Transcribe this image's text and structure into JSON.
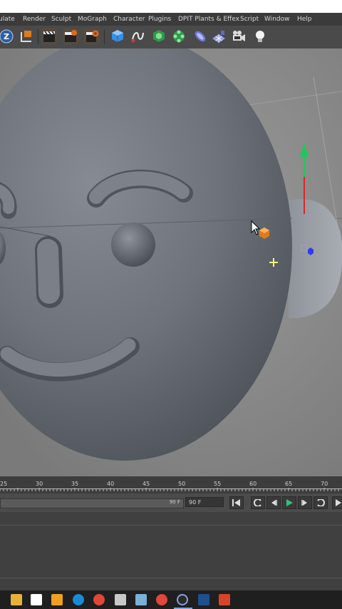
{
  "menu": [
    "ulate",
    "Render",
    "Sculpt",
    "MoGraph",
    "Character",
    "Plugins",
    "DPIT Plants & Effex",
    "Script",
    "Window",
    "Help"
  ],
  "toolbar_icons": [
    "z-icon",
    "coordinate-icon",
    "render-view-icon",
    "render-picture-icon",
    "render-settings-icon",
    "cube-icon",
    "spline-icon",
    "generator-icon",
    "array-icon",
    "deformer-icon",
    "floor-icon",
    "camera-icon",
    "light-icon"
  ],
  "timeline": {
    "ticks": [
      "25",
      "30",
      "35",
      "40",
      "45",
      "50",
      "55",
      "60",
      "65",
      "70"
    ]
  },
  "controls": {
    "slider_value": "90 F",
    "current_frame": "90 F"
  },
  "taskbar_icons": [
    "file-explorer-icon",
    "store-icon",
    "app-icon",
    "edge-icon",
    "chrome-icon",
    "calculator-icon",
    "notes-icon",
    "chrome-icon",
    "cinema4d-icon",
    "photoshop-icon",
    "office-icon"
  ],
  "colors": {
    "menubar": "#3b3b3b",
    "toolbar": "#4a4a4a",
    "viewport_bg": "#8c8c8c",
    "head": "#6e737b",
    "y_axis": "#22c55e",
    "x_axis": "#dc2626",
    "handle": "#2f3bf0",
    "taskbar": "#1f1f1f"
  }
}
